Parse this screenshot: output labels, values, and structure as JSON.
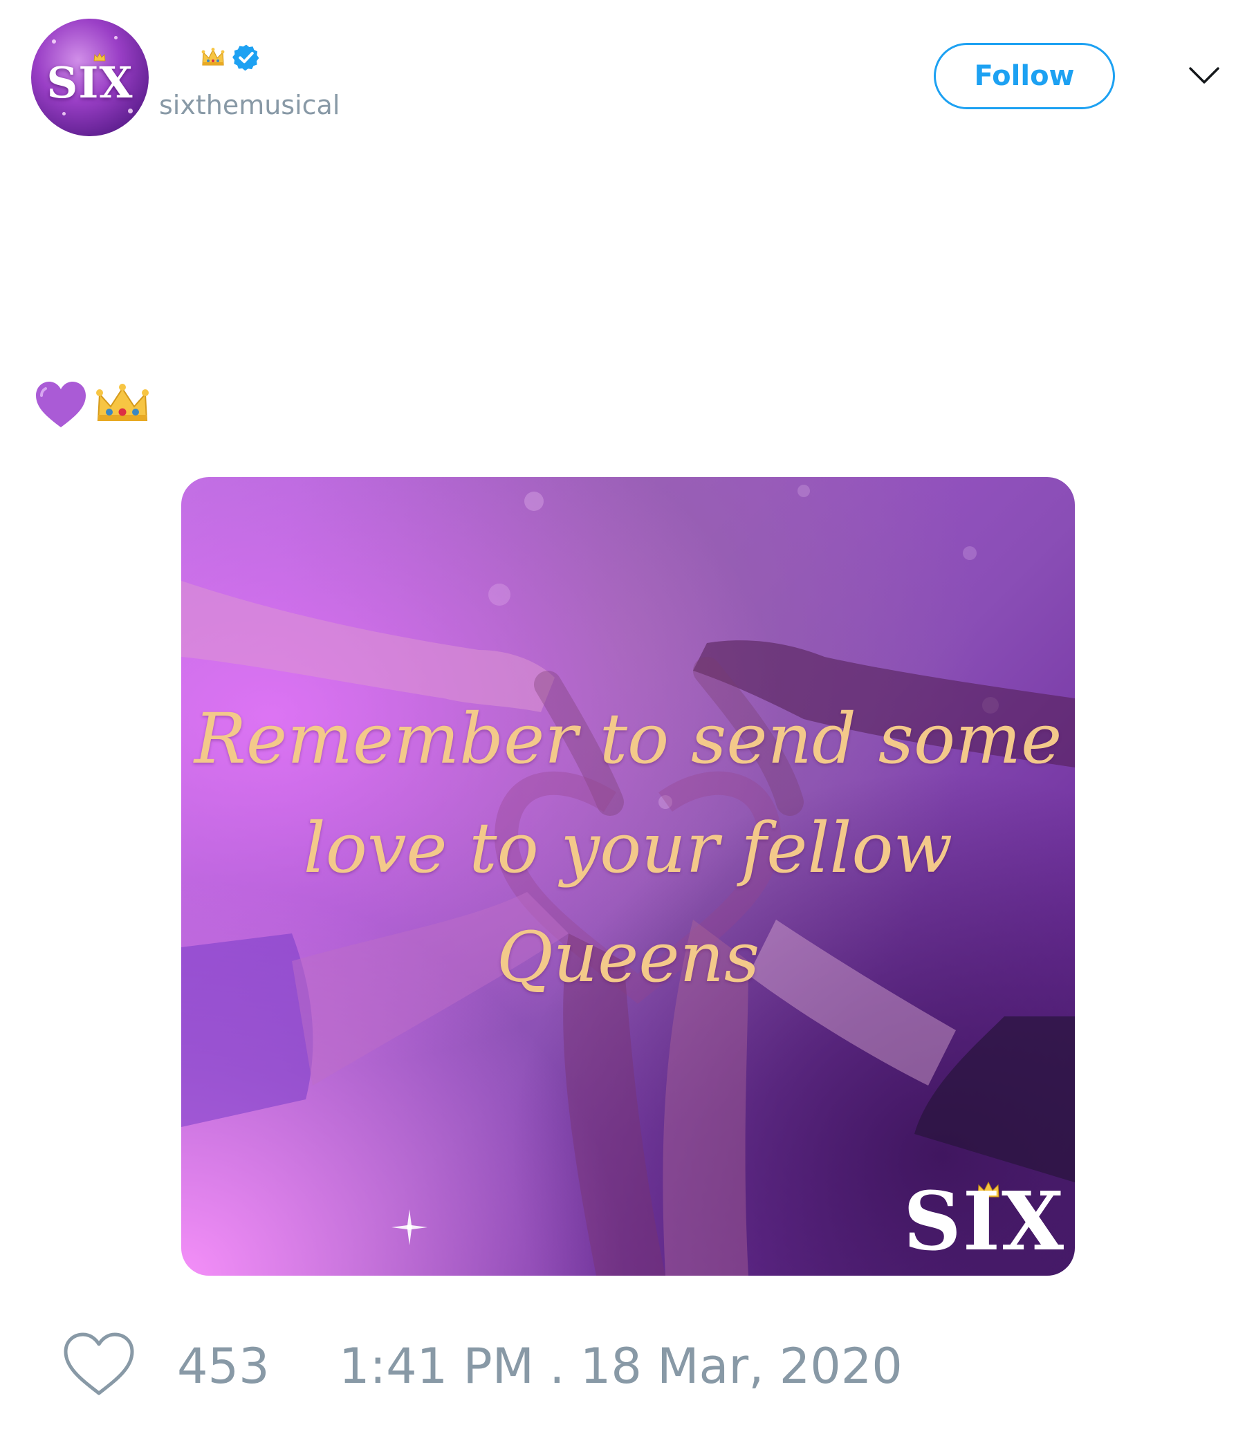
{
  "tweet": {
    "avatar": {
      "logo_text": "SIX"
    },
    "author": {
      "name_emoji": "crown-emoji",
      "verified": true,
      "handle": "sixthemusical"
    },
    "follow_label": "Follow",
    "body_emojis": [
      "purple-heart-emoji",
      "crown-emoji"
    ],
    "media": {
      "quote_lines": [
        "Remember to send some",
        "love to your fellow",
        "Queens"
      ],
      "logo_text": "SIX"
    },
    "likes": "453",
    "timestamp": "1:41 PM . 18 Mar, 2020"
  },
  "colors": {
    "accent": "#1da1f2",
    "muted_text": "#8899a6",
    "quote_gold": "#f3c98a",
    "purple": "#9d56c8"
  }
}
